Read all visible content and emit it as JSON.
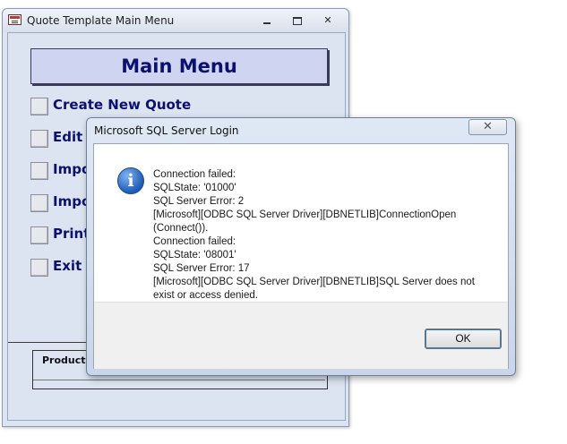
{
  "access_window": {
    "title": "Quote Template Main Menu",
    "close_glyph": "✕",
    "main_menu_title": "Main Menu",
    "menu_items": [
      {
        "label": "Create New Quote"
      },
      {
        "label": "Edit E"
      },
      {
        "label": "Impo"
      },
      {
        "label": "Impo"
      },
      {
        "label": "Print"
      },
      {
        "label": "Exit"
      }
    ],
    "production_label": "Productio"
  },
  "dialog": {
    "title": "Microsoft SQL Server Login",
    "close_glyph": "✕",
    "message_lines": [
      "Connection failed:",
      "SQLState: '01000'",
      "SQL Server Error: 2",
      "[Microsoft][ODBC SQL Server Driver][DBNETLIB]ConnectionOpen",
      "(Connect()).",
      "Connection failed:",
      "SQLState: '08001'",
      "SQL Server Error: 17",
      "[Microsoft][ODBC SQL Server Driver][DBNETLIB]SQL Server does not",
      "exist or access denied."
    ],
    "info_glyph": "i",
    "ok_label": "OK"
  },
  "icons": {
    "app": "access-form-icon",
    "info": "information-icon"
  }
}
